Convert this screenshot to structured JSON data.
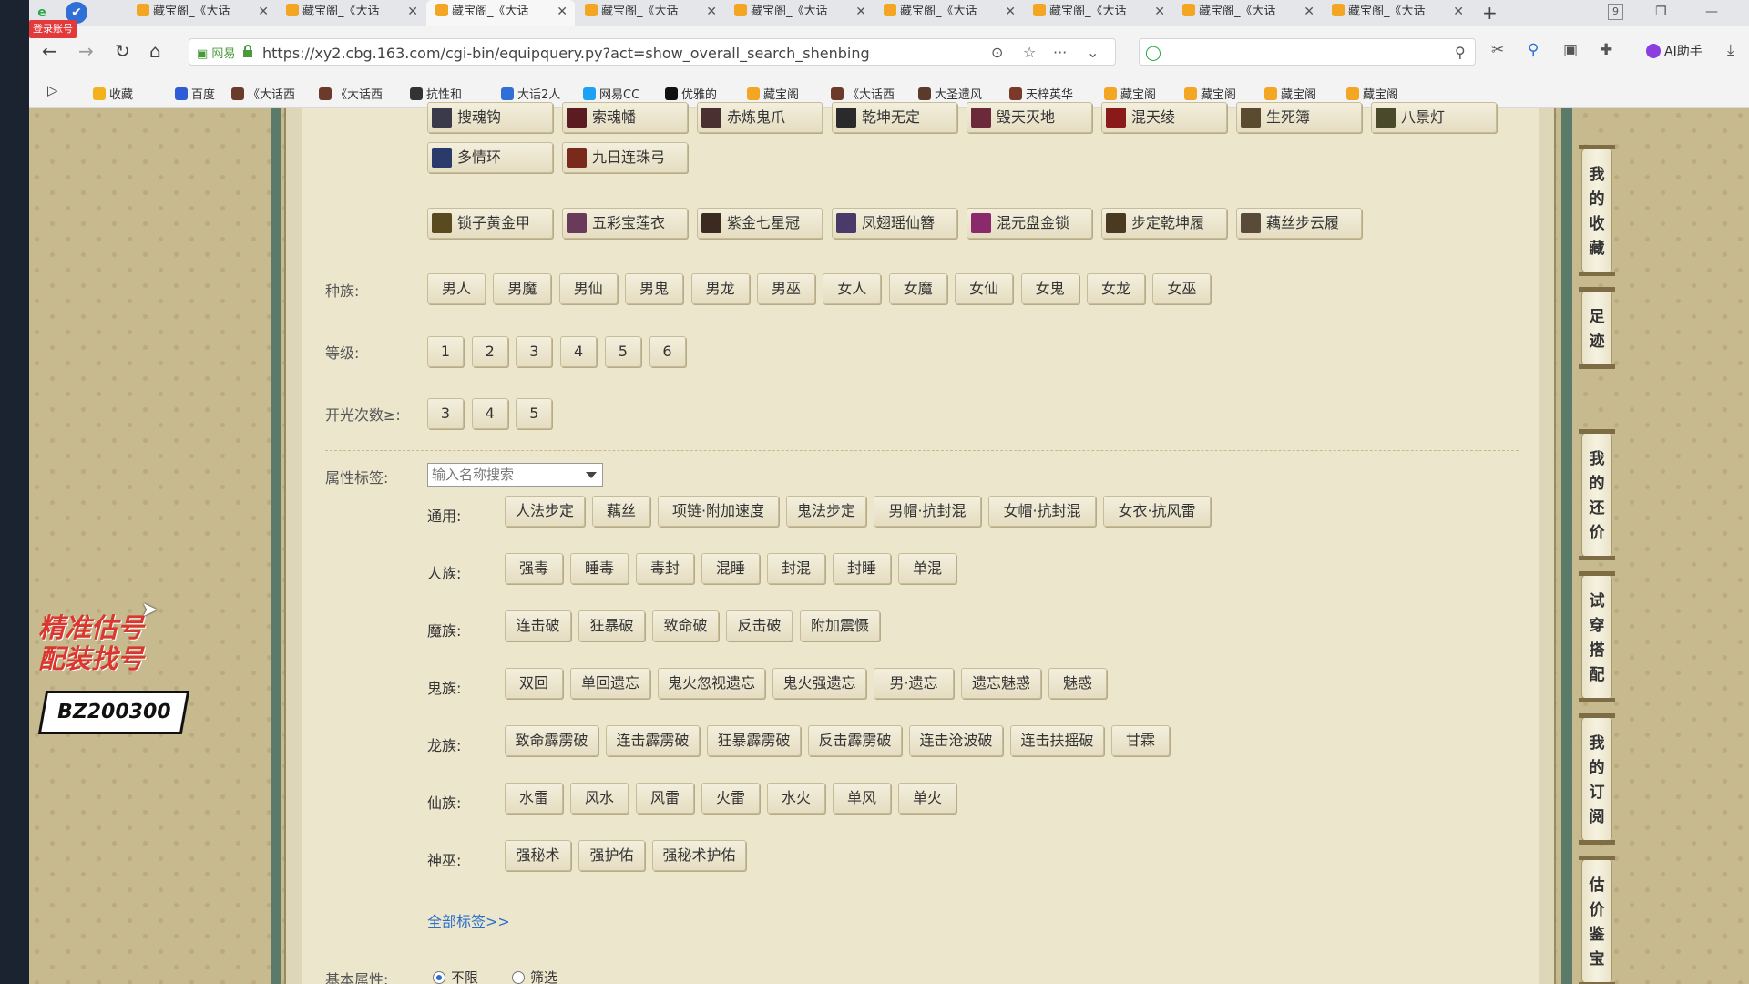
{
  "browser": {
    "login_badge": "登录账号",
    "tab_title": "藏宝阁_《大话",
    "tab_close": "✕",
    "tabs": [
      "藏宝阁_《大话",
      "藏宝阁_《大话",
      "藏宝阁_《大话",
      "藏宝阁_《大话",
      "藏宝阁_《大话",
      "藏宝阁_《大话",
      "藏宝阁_《大话",
      "藏宝阁_《大话",
      "藏宝阁_《大话"
    ],
    "new_tab": "+",
    "tab_count": "9",
    "security_label": "网易",
    "url": "https://xy2.cbg.163.com/cgi-bin/equipquery.py?act=show_overall_search_shenbing",
    "ai_label": "AI助手",
    "bookmarks": [
      "收藏",
      "百度",
      "《大话西",
      "《大话西",
      "抗性和",
      "大话2人",
      "网易CC",
      "优雅的",
      "藏宝阁",
      "《大话西",
      "大圣遗风",
      "天梓英华",
      "藏宝阁",
      "藏宝阁",
      "藏宝阁",
      "藏宝阁"
    ]
  },
  "icon_colors": {
    "accent_link": "#2b6fcc",
    "promo_red": "#d93830"
  },
  "weapons_row1": [
    "搜魂钩",
    "索魂幡",
    "赤炼鬼爪",
    "乾坤无定",
    "毁天灭地",
    "混天绫",
    "生死簿",
    "八景灯"
  ],
  "weapons_row2": [
    "多情环",
    "九日连珠弓"
  ],
  "armor_row": [
    "锁子黄金甲",
    "五彩宝莲衣",
    "紫金七星冠",
    "凤翅瑶仙簪",
    "混元盘金锁",
    "步定乾坤履",
    "藕丝步云履"
  ],
  "race": {
    "label": "种族:",
    "options": [
      "男人",
      "男魔",
      "男仙",
      "男鬼",
      "男龙",
      "男巫",
      "女人",
      "女魔",
      "女仙",
      "女鬼",
      "女龙",
      "女巫"
    ]
  },
  "level": {
    "label": "等级:",
    "options": [
      "1",
      "2",
      "3",
      "4",
      "5",
      "6"
    ]
  },
  "kaiguang": {
    "label": "开光次数≥:",
    "options": [
      "3",
      "4",
      "5"
    ]
  },
  "attr": {
    "label": "属性标签:",
    "placeholder": "输入名称搜索",
    "groups": [
      {
        "label": "通用:",
        "tags": [
          "人法步定",
          "藕丝",
          "项链·附加速度",
          "鬼法步定",
          "男帽·抗封混",
          "女帽·抗封混",
          "女衣·抗风雷"
        ]
      },
      {
        "label": "人族:",
        "tags": [
          "强毒",
          "睡毒",
          "毒封",
          "混睡",
          "封混",
          "封睡",
          "单混"
        ]
      },
      {
        "label": "魔族:",
        "tags": [
          "连击破",
          "狂暴破",
          "致命破",
          "反击破",
          "附加震慑"
        ]
      },
      {
        "label": "鬼族:",
        "tags": [
          "双回",
          "单回遗忘",
          "鬼火忽视遗忘",
          "鬼火强遗忘",
          "男·遗忘",
          "遗忘魅惑",
          "魅惑"
        ]
      },
      {
        "label": "龙族:",
        "tags": [
          "致命霹雳破",
          "连击霹雳破",
          "狂暴霹雳破",
          "反击霹雳破",
          "连击沧波破",
          "连击扶摇破",
          "甘霖"
        ]
      },
      {
        "label": "仙族:",
        "tags": [
          "水雷",
          "风水",
          "风雷",
          "火雷",
          "水火",
          "单风",
          "单火"
        ]
      },
      {
        "label": "神巫:",
        "tags": [
          "强秘术",
          "强护佑",
          "强秘术护佑"
        ]
      }
    ],
    "all_tags_link": "全部标签>>"
  },
  "basic": {
    "label": "基本属性:",
    "options": [
      "不限",
      "筛选"
    ],
    "selected": "不限"
  },
  "side_tabs": [
    "我的收藏",
    "足迹",
    "我的还价",
    "试穿搭配",
    "我的订阅",
    "估价鉴宝"
  ],
  "promo": {
    "line1": "精准估号",
    "line2": "配装找号",
    "code": "BZ200300"
  }
}
